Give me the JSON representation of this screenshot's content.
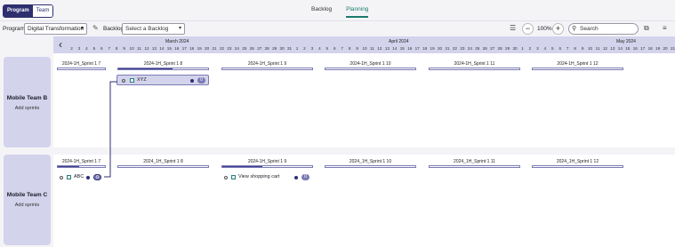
{
  "topbar": {
    "toggle": {
      "program": "Program",
      "team": "Team"
    },
    "tabs": [
      {
        "label": "Backlog"
      },
      {
        "label": "Planning"
      }
    ],
    "active_tab": "Planning"
  },
  "filters": {
    "program_label": "Program",
    "program_value": "Digital Transformation",
    "backlog_label": "Backlog",
    "backlog_placeholder": "Select a Backlog",
    "zoom": "100%",
    "search_placeholder": "Search"
  },
  "timeline": {
    "months": [
      "March 2024",
      "April 2024",
      "May 2024"
    ],
    "days": [
      "2",
      "3",
      "4",
      "5",
      "6",
      "7",
      "8",
      "9",
      "10",
      "11",
      "12",
      "13",
      "14",
      "15",
      "16",
      "17",
      "18",
      "19",
      "20",
      "21",
      "22",
      "23",
      "24",
      "25",
      "26",
      "27",
      "28",
      "29",
      "30",
      "31",
      "1",
      "2",
      "3",
      "4",
      "5",
      "6",
      "7",
      "8",
      "9",
      "10",
      "11",
      "12",
      "13",
      "14",
      "15",
      "16",
      "17",
      "18",
      "19",
      "20",
      "21",
      "22",
      "23",
      "24",
      "25",
      "26",
      "27",
      "28",
      "29",
      "30",
      "1",
      "2",
      "3",
      "4",
      "5",
      "6",
      "7",
      "8",
      "9",
      "10",
      "11",
      "12",
      "13",
      "14",
      "15",
      "16",
      "17",
      "18",
      "19",
      "20",
      "21",
      "22"
    ]
  },
  "teams": [
    {
      "name": "Mobile Team B",
      "add_sprints": "Add sprints",
      "sprints": [
        {
          "name": "2024-1H_Sprint 1 7",
          "progress": 0
        },
        {
          "name": "2024-1H_Sprint 1 8",
          "progress": 0.6
        },
        {
          "name": "2024-1H_Sprint 1 9",
          "progress": 0
        },
        {
          "name": "2024-1H_Sprint 1 10",
          "progress": 0
        },
        {
          "name": "2024-1H_Sprint 1 11",
          "progress": 0
        },
        {
          "name": "2024-1H_Sprint 1 12",
          "progress": 0
        }
      ],
      "cards": [
        {
          "title": "XYZ",
          "count": "0",
          "highlighted": true
        }
      ]
    },
    {
      "name": "Mobile Team C",
      "add_sprints": "Add sprints",
      "sprints": [
        {
          "name": "2024-1H_Sprint 1 7",
          "progress": 0.45
        },
        {
          "name": "2024_1H_Sprint 1 8",
          "progress": 0
        },
        {
          "name": "2024-1H_Sprint 1 9",
          "progress": 0.45
        },
        {
          "name": "2024_1H_Sprint 1 10",
          "progress": 0
        },
        {
          "name": "2024_1H_Sprint 1 11",
          "progress": 0
        },
        {
          "name": "2024_1H_Sprint 1 12",
          "progress": 0
        }
      ],
      "cards": [
        {
          "title": "ABC",
          "count": "0",
          "highlighted": false
        },
        {
          "title": "View shopping cart",
          "count": "0",
          "highlighted": false
        }
      ]
    }
  ],
  "colors": {
    "accent": "#2d2f6e",
    "active_tab": "#197a6d",
    "lavender": "#d3d3ec"
  }
}
